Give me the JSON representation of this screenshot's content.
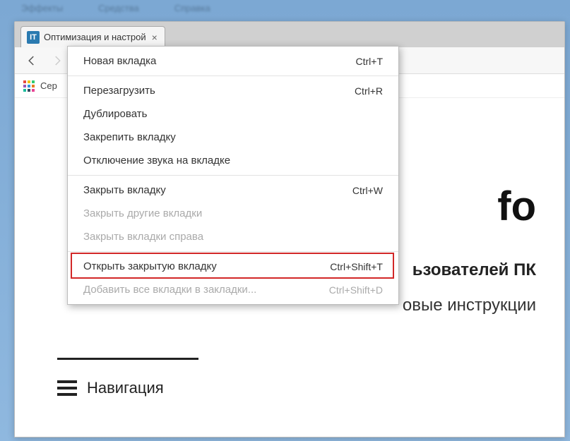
{
  "bg_menu": [
    "Эффекты",
    "Средства",
    "Справка"
  ],
  "tab": {
    "favicon_text": "IT",
    "title": "Оптимизация и настрой"
  },
  "bookmarks": {
    "apps_label": "Сер"
  },
  "page": {
    "logo_fragment": "fo",
    "subtitle_fragment": "ьзователей ПК",
    "tagline_fragment": "овые инструкции",
    "nav_label": "Навигация"
  },
  "menu": {
    "items": [
      {
        "label": "Новая вкладка",
        "shortcut": "Ctrl+T",
        "disabled": false
      },
      {
        "sep": true
      },
      {
        "label": "Перезагрузить",
        "shortcut": "Ctrl+R",
        "disabled": false
      },
      {
        "label": "Дублировать",
        "shortcut": "",
        "disabled": false
      },
      {
        "label": "Закрепить вкладку",
        "shortcut": "",
        "disabled": false
      },
      {
        "label": "Отключение звука на вкладке",
        "shortcut": "",
        "disabled": false
      },
      {
        "sep": true
      },
      {
        "label": "Закрыть вкладку",
        "shortcut": "Ctrl+W",
        "disabled": false
      },
      {
        "label": "Закрыть другие вкладки",
        "shortcut": "",
        "disabled": true
      },
      {
        "label": "Закрыть вкладки справа",
        "shortcut": "",
        "disabled": true
      },
      {
        "sep": true
      },
      {
        "label": "Открыть закрытую вкладку",
        "shortcut": "Ctrl+Shift+T",
        "disabled": false,
        "highlighted": true
      },
      {
        "label": "Добавить все вкладки в закладки...",
        "shortcut": "Ctrl+Shift+D",
        "disabled": true
      }
    ]
  }
}
